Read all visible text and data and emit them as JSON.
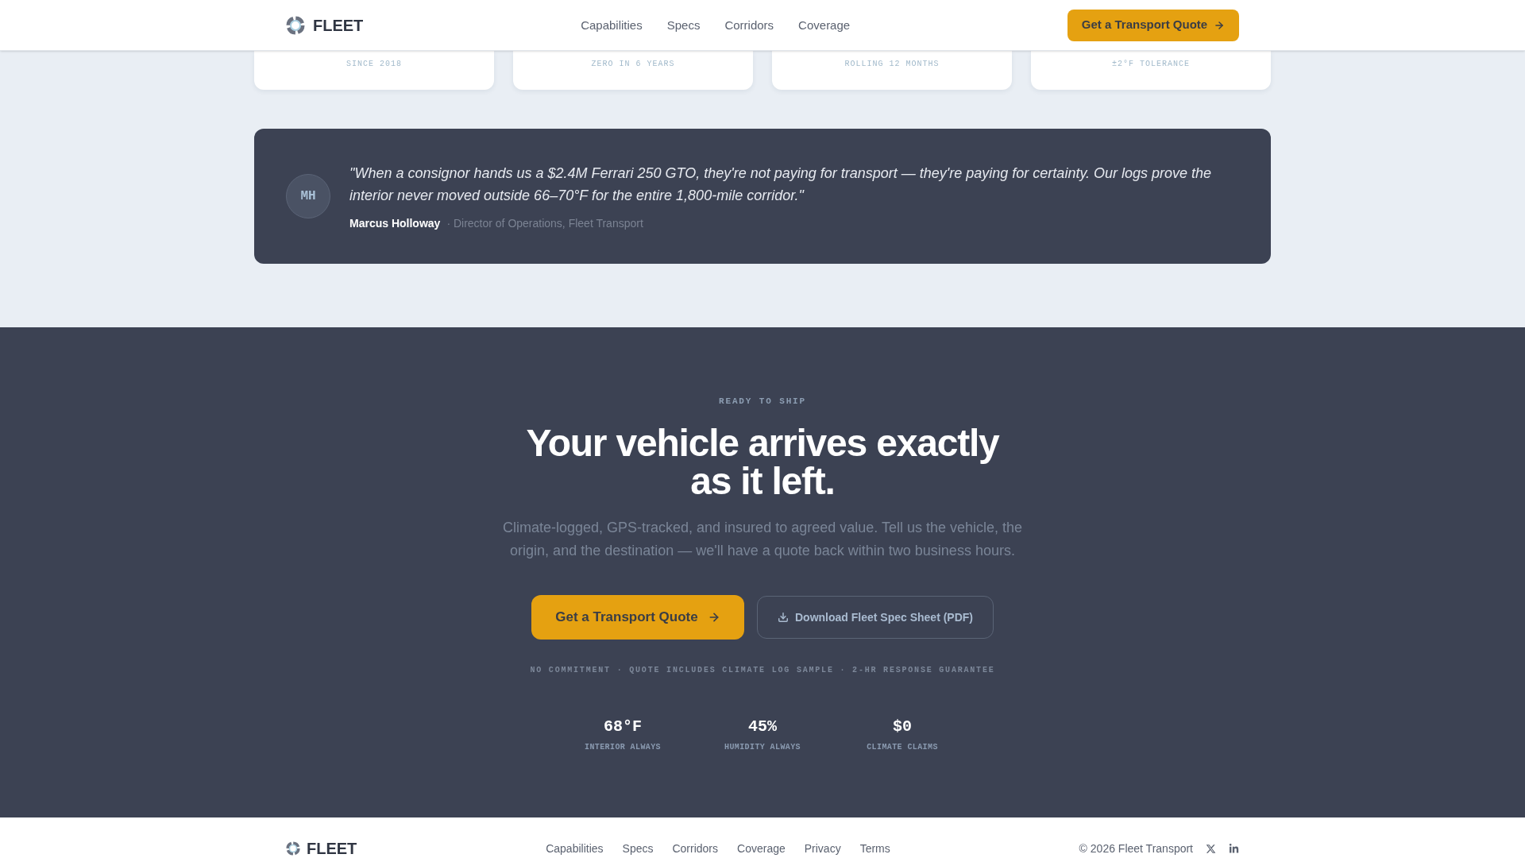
{
  "header": {
    "brand": "FLEET",
    "nav": [
      "Capabilities",
      "Specs",
      "Corridors",
      "Coverage"
    ],
    "cta": "Get a Transport Quote"
  },
  "stat_cards": [
    {
      "caption": "SINCE 2018"
    },
    {
      "caption": "ZERO IN 6 YEARS"
    },
    {
      "caption": "ROLLING 12 MONTHS"
    },
    {
      "caption": "±2°F TOLERANCE"
    }
  ],
  "testimonial": {
    "initials": "MH",
    "quote": "\"When a consignor hands us a $2.4M Ferrari 250 GTO, they're not paying for transport — they're paying for certainty. Our logs prove the interior never moved outside 66–70°F for the entire 1,800-mile corridor.\"",
    "author": "Marcus Holloway",
    "role": "· Director of Operations, Fleet Transport"
  },
  "cta_section": {
    "eyebrow": "READY TO SHIP",
    "headline": "Your vehicle arrives exactly as it left.",
    "body": "Climate-logged, GPS-tracked, and insured to agreed value. Tell us the vehicle, the origin, and the destination — we'll have a quote back within two business hours.",
    "primary_button": "Get a Transport Quote",
    "secondary_button": "Download Fleet Spec Sheet (PDF)",
    "fine_print": "NO COMMITMENT · QUOTE INCLUDES CLIMATE LOG SAMPLE · 2-HR RESPONSE GUARANTEE",
    "stats": [
      {
        "value": "68°F",
        "label": "INTERIOR ALWAYS"
      },
      {
        "value": "45%",
        "label": "HUMIDITY ALWAYS"
      },
      {
        "value": "$0",
        "label": "CLIMATE CLAIMS"
      }
    ]
  },
  "footer": {
    "brand": "FLEET",
    "links": [
      "Capabilities",
      "Specs",
      "Corridors",
      "Coverage",
      "Privacy",
      "Terms"
    ],
    "copyright": "© 2026 Fleet Transport"
  }
}
